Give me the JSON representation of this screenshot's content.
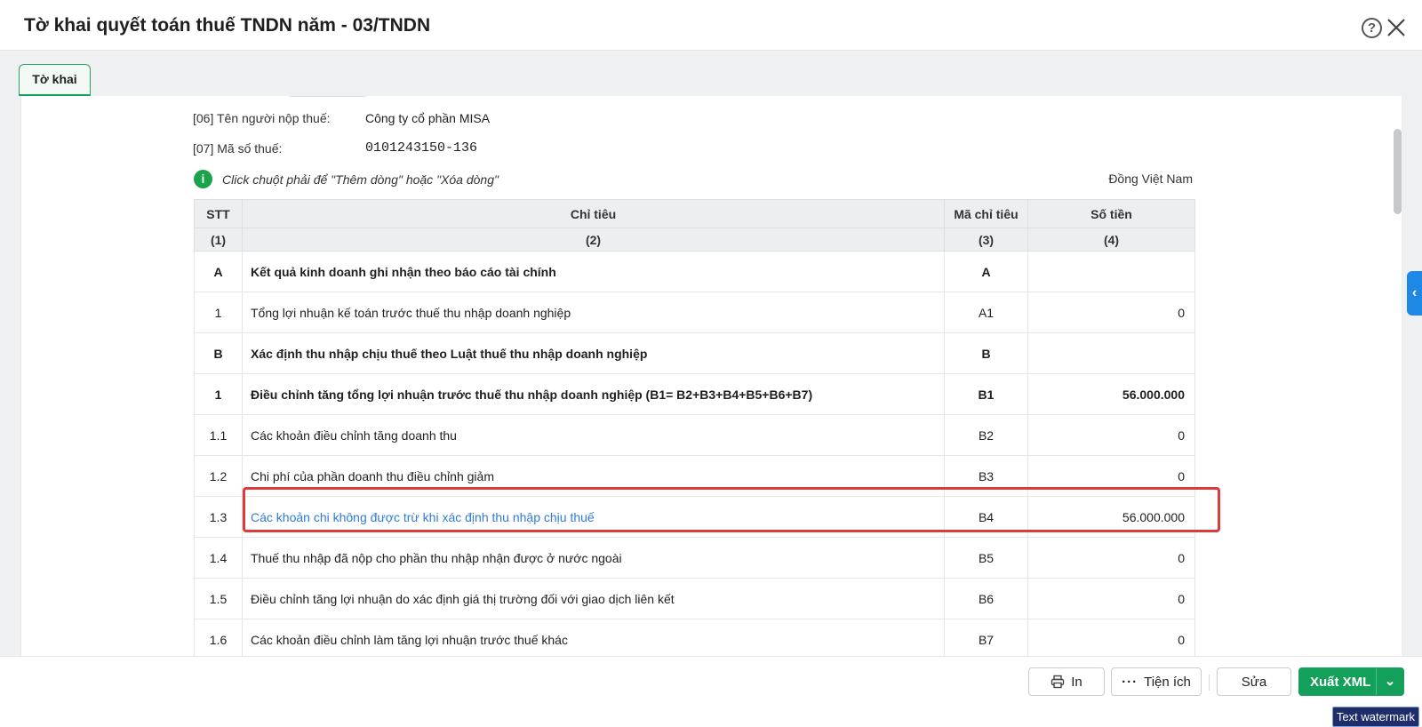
{
  "header": {
    "title": "Tờ khai quyết toán thuế TNDN năm - 03/TNDN",
    "help_icon": "?"
  },
  "tabs": [
    {
      "label": "Tờ khai"
    }
  ],
  "info": {
    "taxpayer_label": "[06] Tên người nộp thuế:",
    "taxpayer_value": "Công ty cổ phần MISA",
    "taxcode_label": "[07] Mã số thuế:",
    "taxcode_value": "0101243150-136",
    "hint": "Click chuột phải để \"Thêm dòng\" hoặc \"Xóa dòng\"",
    "currency": "Đồng Việt Nam"
  },
  "table": {
    "headers": [
      "STT",
      "Chỉ tiêu",
      "Mã chỉ tiêu",
      "Số tiền"
    ],
    "subheaders": [
      "(1)",
      "(2)",
      "(3)",
      "(4)"
    ],
    "rows": [
      {
        "stt": "A",
        "desc": "Kết quả kinh doanh ghi nhận theo báo cáo tài chính",
        "code": "A",
        "amount": ""
      },
      {
        "stt": "1",
        "desc": "Tổng lợi nhuận kế toán trước thuế thu nhập doanh nghiệp",
        "code": "A1",
        "amount": "0"
      },
      {
        "stt": "B",
        "desc": "Xác định thu nhập chịu thuế theo Luật thuế thu nhập doanh nghiệp",
        "code": "B",
        "amount": ""
      },
      {
        "stt": "1",
        "desc": "Điều chỉnh tăng tổng lợi nhuận trước thuế thu nhập doanh nghiệp (B1= B2+B3+B4+B5+B6+B7)",
        "code": "B1",
        "amount": "56.000.000"
      },
      {
        "stt": "1.1",
        "desc": "Các khoản điều chỉnh tăng doanh thu",
        "code": "B2",
        "amount": "0"
      },
      {
        "stt": "1.2",
        "desc": "Chi phí của phần doanh thu điều chỉnh giảm",
        "code": "B3",
        "amount": "0"
      },
      {
        "stt": "1.3",
        "desc": "Các khoản chi không được trừ khi xác định thu nhập chịu thuế",
        "code": "B4",
        "amount": "56.000.000"
      },
      {
        "stt": "1.4",
        "desc": "Thuế thu nhập đã nộp cho phần thu nhập nhận được ở nước ngoài",
        "code": "B5",
        "amount": "0"
      },
      {
        "stt": "1.5",
        "desc": "Điều chỉnh tăng lợi nhuận do xác định giá thị trường đối với giao dịch liên kết",
        "code": "B6",
        "amount": "0"
      },
      {
        "stt": "1.6",
        "desc": "Các khoản điều chỉnh làm tăng lợi nhuận trước thuế khác",
        "code": "B7",
        "amount": "0"
      }
    ]
  },
  "footer": {
    "print_label": "In",
    "tools_label": "Tiện ích",
    "edit_label": "Sửa",
    "export_label": "Xuất XML"
  },
  "watermark": "Text watermark",
  "colors": {
    "accent_green": "#13a05a",
    "link_blue": "#2f7bd8",
    "highlight_red": "#dd3b3b"
  }
}
